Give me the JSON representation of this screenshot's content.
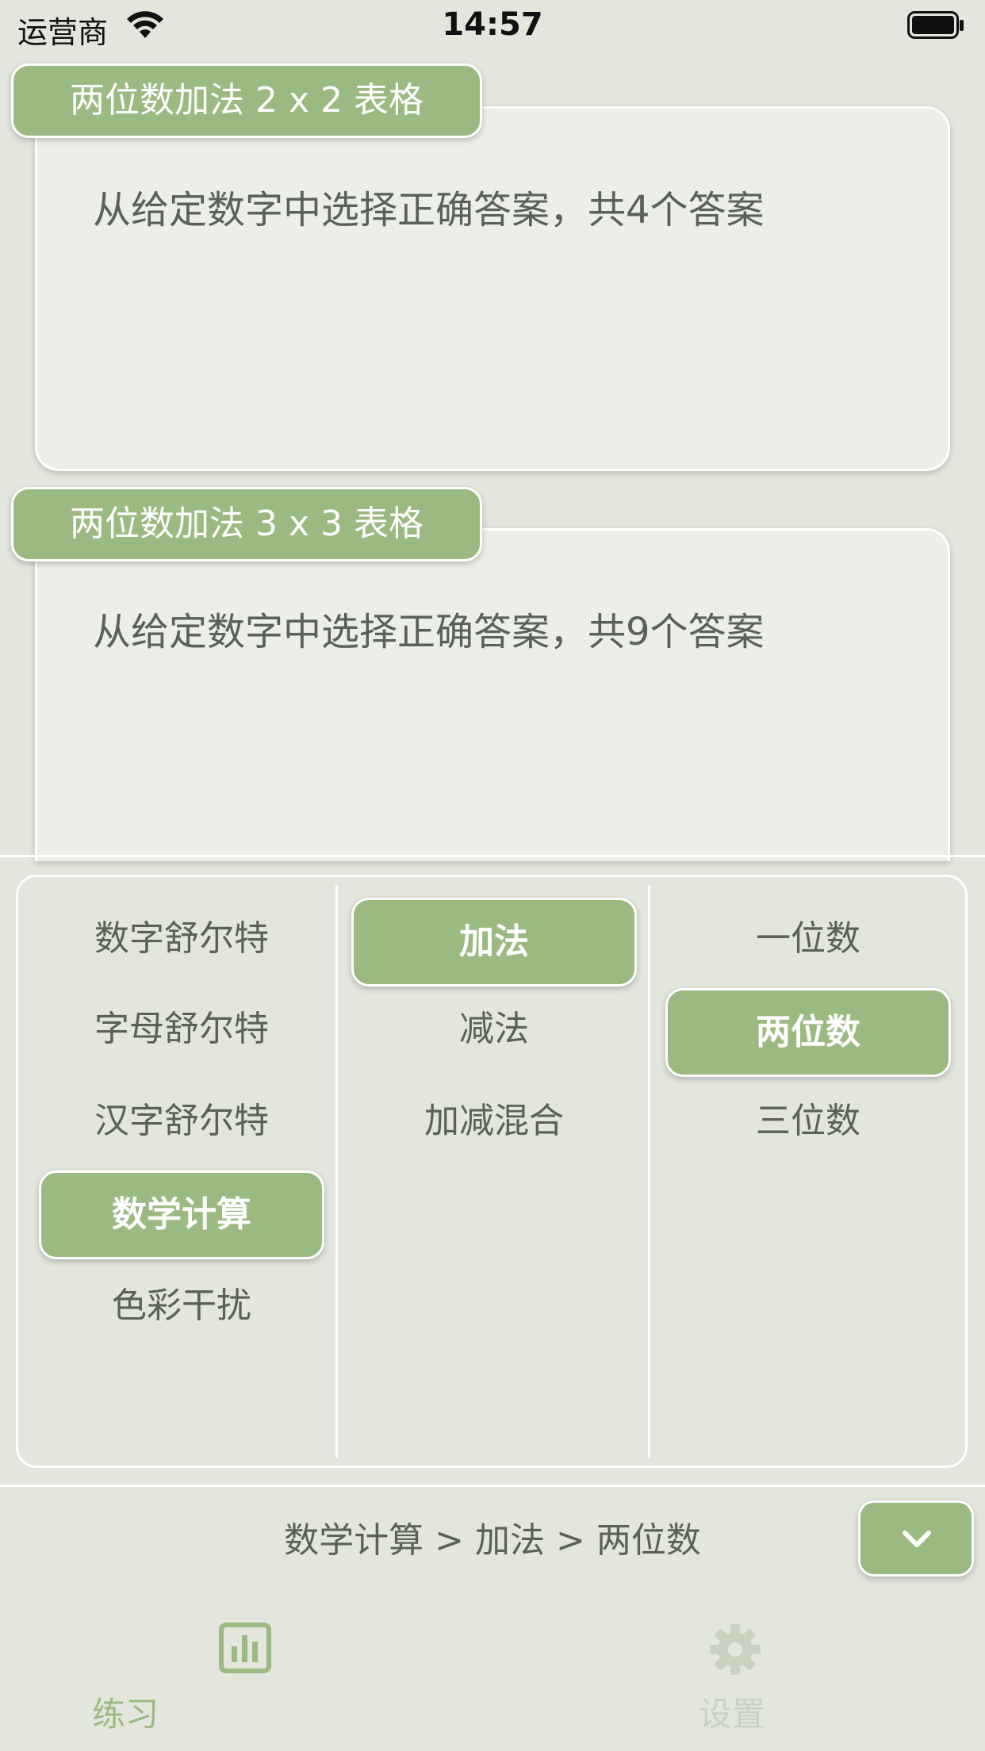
{
  "status_bar": {
    "carrier": "运营商",
    "time": "14:57"
  },
  "cards": [
    {
      "title": "两位数加法 2 x 2 表格",
      "description": "从给定数字中选择正确答案，共4个答案"
    },
    {
      "title": "两位数加法 3 x 3 表格",
      "description": "从给定数字中选择正确答案，共9个答案"
    }
  ],
  "picker": {
    "column1": [
      "数字舒尔特",
      "字母舒尔特",
      "汉字舒尔特",
      "数学计算",
      "色彩干扰"
    ],
    "column2": [
      "加法",
      "减法",
      "加减混合"
    ],
    "column3": [
      "一位数",
      "两位数",
      "三位数"
    ]
  },
  "breadcrumb": "数学计算 > 加法 > 两位数",
  "tabs": [
    {
      "label": "练习",
      "icon": "bar-chart-icon"
    },
    {
      "label": "设置",
      "icon": "gear-icon"
    }
  ],
  "colors": {
    "accent": "#9bba82",
    "background": "#e2e6dc",
    "card": "#ebefe7",
    "text": "#5b6157",
    "inactive": "#c9d2c0"
  }
}
